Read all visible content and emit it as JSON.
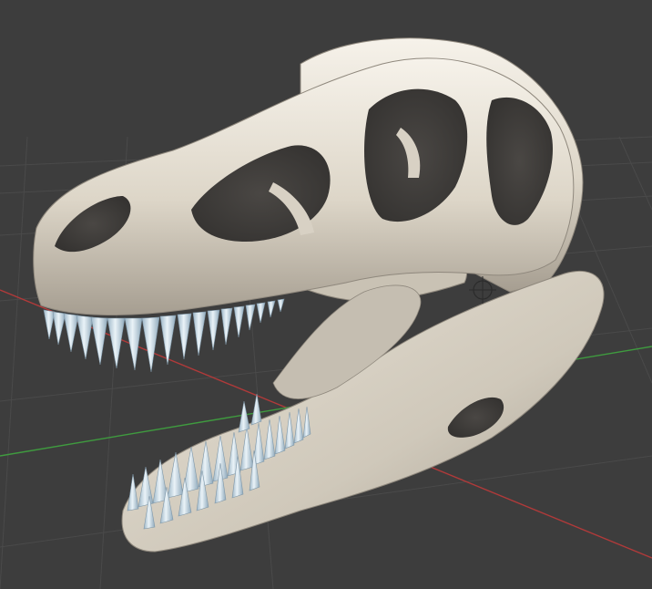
{
  "viewport": {
    "background": "#3d3d3d",
    "grid_color": "#4a4a4a",
    "x_axis_color": "#b03a3a",
    "y_axis_color": "#3f9b3f"
  },
  "model": {
    "name": "skull-model",
    "bone_color": "#ddd6c8",
    "bone_shadow": "#a69e91",
    "bone_highlight": "#f7f3ea",
    "teeth_color": "#c7dbe8",
    "teeth_shadow": "#8fa9bb"
  },
  "scene_widgets": {
    "origin_marker": "3d-cursor-icon"
  }
}
